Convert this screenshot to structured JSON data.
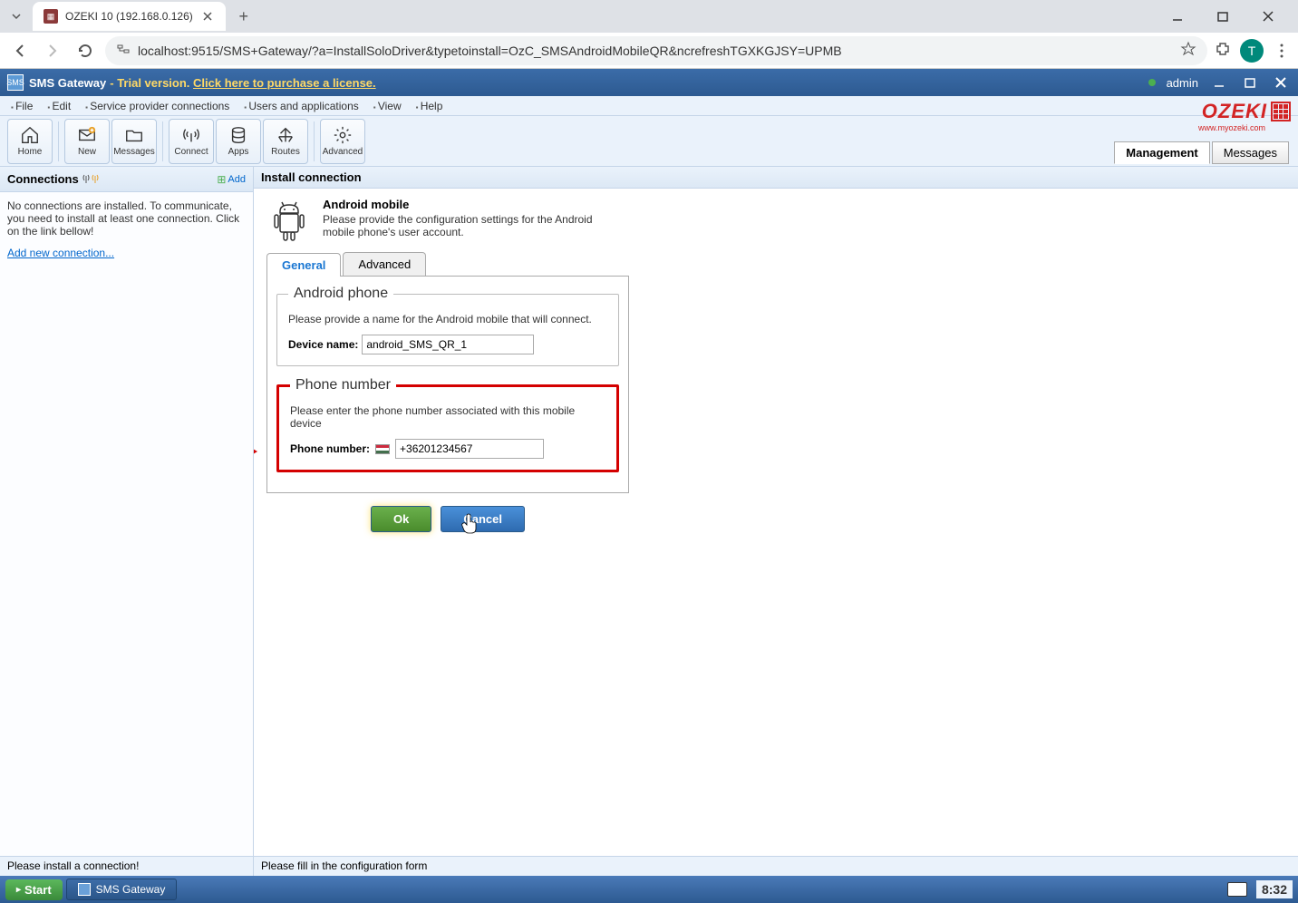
{
  "browser": {
    "tab_title": "OZEKI 10 (192.168.0.126)",
    "url": "localhost:9515/SMS+Gateway/?a=InstallSoloDriver&typetoinstall=OzC_SMSAndroidMobileQR&ncrefreshTGXKGJSY=UPMB",
    "profile_letter": "T"
  },
  "app_header": {
    "title": "SMS Gateway",
    "trial": " - Trial version.",
    "license_link": "Click here to purchase a license.",
    "user": "admin"
  },
  "menu": {
    "file": "File",
    "edit": "Edit",
    "spc": "Service provider connections",
    "users": "Users and applications",
    "view": "View",
    "help": "Help"
  },
  "logo": {
    "text": "OZEKI",
    "sub": "www.myozeki.com"
  },
  "toolbar": {
    "home": "Home",
    "new": "New",
    "messages": "Messages",
    "connect": "Connect",
    "apps": "Apps",
    "routes": "Routes",
    "advanced": "Advanced"
  },
  "topright_tabs": {
    "management": "Management",
    "messages": "Messages"
  },
  "left_panel": {
    "title": "Connections",
    "add": "Add",
    "empty_text": "No connections are installed. To communicate, you need to install at least one connection. Click on the link bellow!",
    "add_link": "Add new connection..."
  },
  "right_panel": {
    "header": "Install connection",
    "title": "Android mobile",
    "desc": "Please provide the configuration settings for the Android mobile phone's user account.",
    "tabs": {
      "general": "General",
      "advanced": "Advanced"
    },
    "section1": {
      "legend": "Android phone",
      "desc": "Please provide a name for the Android mobile that will connect.",
      "label": "Device name:",
      "value": "android_SMS_QR_1"
    },
    "section2": {
      "legend": "Phone number",
      "desc": "Please enter the phone number associated with this mobile device",
      "label": "Phone number:",
      "value": "+36201234567"
    },
    "ok": "Ok",
    "cancel": "Cancel"
  },
  "status": {
    "left": "Please install a connection!",
    "right": "Please fill in the configuration form"
  },
  "taskbar": {
    "start": "Start",
    "sms_gateway": "SMS Gateway",
    "clock": "8:32"
  }
}
